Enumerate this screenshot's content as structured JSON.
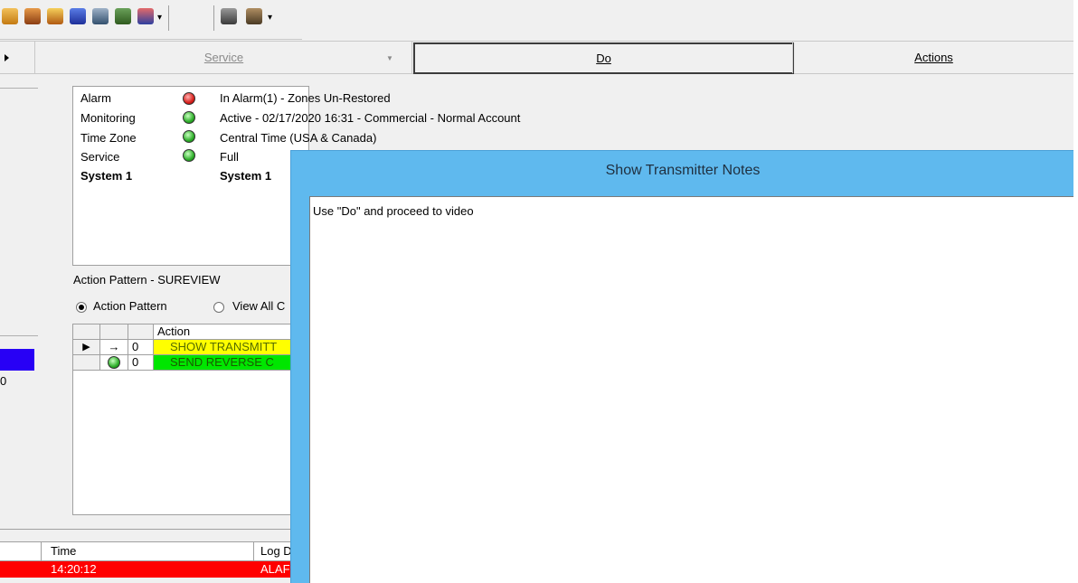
{
  "toolbar": {
    "icons": [
      "house-icon",
      "person-icon",
      "house-person-icon",
      "badge-icon",
      "floppy-icon",
      "guard-icon",
      "heart-icon",
      "book-icon",
      "book-pages-icon"
    ]
  },
  "menubar": {
    "service": "Service",
    "do": "Do",
    "actions": "Actions"
  },
  "status": {
    "rows": [
      {
        "label": "Alarm",
        "indicator": "red",
        "value": "In Alarm(1) - Zones Un-Restored"
      },
      {
        "label": "Monitoring",
        "indicator": "green",
        "value": "Active - 02/17/2020 16:31 - Commercial - Normal Account"
      },
      {
        "label": "Time Zone",
        "indicator": "green",
        "value": "Central Time (USA & Canada)"
      },
      {
        "label": "Service",
        "indicator": "green",
        "value": "Full"
      },
      {
        "label": "System 1",
        "indicator": "",
        "value": "System 1"
      }
    ]
  },
  "action_pattern": {
    "title": "Action Pattern - SUREVIEW",
    "radio_action": "Action Pattern",
    "radio_view": "View All C",
    "grid_header": "Action",
    "rows": [
      {
        "count": "0",
        "action": "SHOW TRANSMITT"
      },
      {
        "count": "0",
        "action": "SEND REVERSE C"
      }
    ]
  },
  "left": {
    "zero": "0"
  },
  "log": {
    "col_time": "Time",
    "col_log": "Log D",
    "row_time": "14:20:12",
    "row_log": "ALAF"
  },
  "dialog": {
    "title": "Show Transmitter Notes",
    "note": "Use \"Do\" and proceed to video"
  },
  "colors": {
    "dialog_bg": "#5fb9ee",
    "alarm_row": "#ff0000",
    "row_yellow": "#ffff00",
    "row_green": "#00e600",
    "left_blue": "#2800f5"
  }
}
